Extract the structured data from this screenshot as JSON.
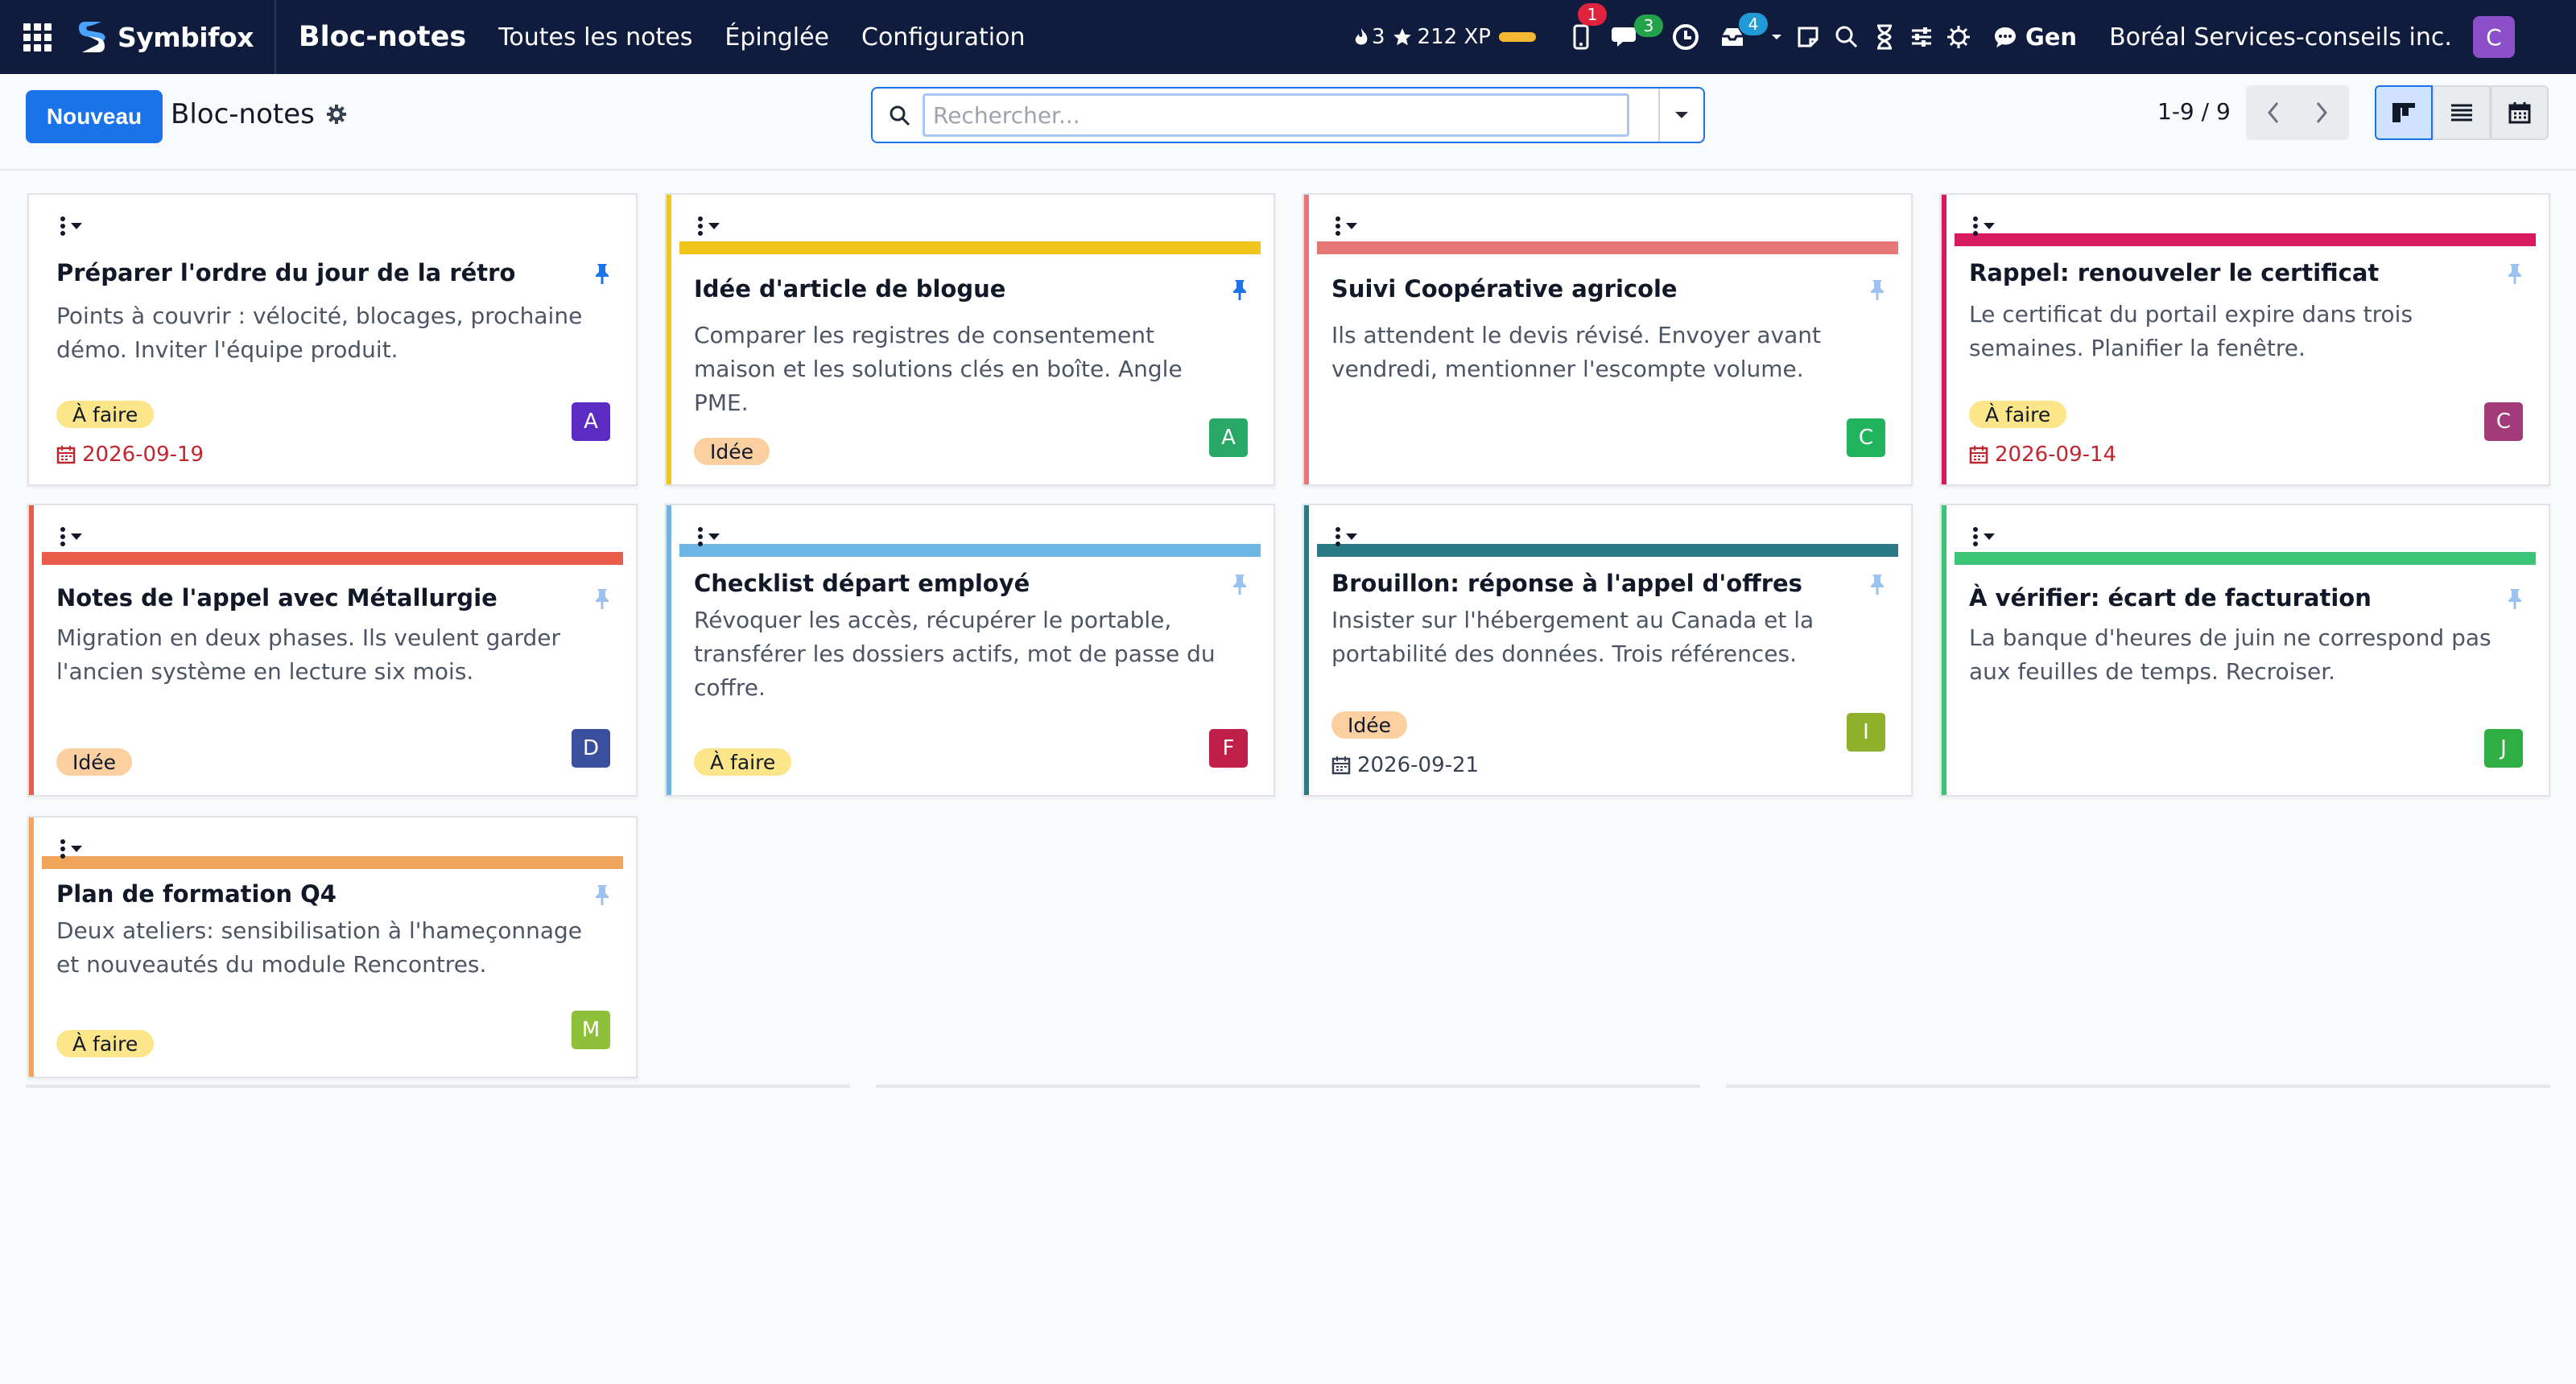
{
  "topbar": {
    "brand": "Symbifox",
    "app_title": "Bloc-notes",
    "menu": [
      "Toutes les notes",
      "Épinglée",
      "Configuration"
    ],
    "streak": "3",
    "xp": "212 XP",
    "badges": {
      "phone": "1",
      "chat": "3",
      "inbox": "4"
    },
    "gen_label": "Gen",
    "company": "Boréal Services-conseils inc.",
    "user_initial": "C"
  },
  "control": {
    "new_label": "Nouveau",
    "breadcrumb": "Bloc-notes",
    "search_placeholder": "Rechercher...",
    "pager": "1-9 / 9"
  },
  "colors": {
    "accent": "#1a73e8",
    "tag_todo": "#fde68a",
    "tag_idea": "#fbcfa0",
    "date_overdue": "#c0262d"
  },
  "notes": [
    {
      "title": "Préparer l'ordre du jour de la rétro",
      "body": "Points à couvrir : vélocité, blocages, prochaine démo. Inviter l'équipe produit.",
      "tag": "À faire",
      "date": "2026-09-19",
      "date_overdue": true,
      "avatar": "A",
      "avatar_color": "#5b2bc4",
      "color": "",
      "pinned": true
    },
    {
      "title": "Idée d'article de blogue",
      "body": "Comparer les registres de consentement maison et les solutions clés en boîte. Angle PME.",
      "tag": "Idée",
      "date": "",
      "avatar": "A",
      "avatar_color": "#28a866",
      "color": "#f2c51c",
      "pinned": true
    },
    {
      "title": "Suivi Coopérative agricole",
      "body": "Ils attendent le devis révisé. Envoyer avant vendredi, mentionner l'escompte volume.",
      "tag": "",
      "date": "",
      "avatar": "C",
      "avatar_color": "#22b35e",
      "color": "#e87878",
      "pinned": false
    },
    {
      "title": "Rappel: renouveler le certificat",
      "body": "Le certificat du portail expire dans trois semaines. Planifier la fenêtre.",
      "tag": "À faire",
      "date": "2026-09-14",
      "date_overdue": true,
      "avatar": "C",
      "avatar_color": "#a33b7a",
      "color": "#d81a5f",
      "pinned": false
    },
    {
      "title": "Notes de l'appel avec Métallurgie",
      "body": "Migration en deux phases. Ils veulent garder l'ancien système en lecture six mois.",
      "tag": "Idée",
      "date": "",
      "avatar": "D",
      "avatar_color": "#3a4f9e",
      "color": "#ea5c4a",
      "pinned": false
    },
    {
      "title": "Checklist départ employé",
      "body": "Révoquer les accès, récupérer le portable, transférer les dossiers actifs, mot de passe du coffre.",
      "tag": "À faire",
      "date": "",
      "avatar": "F",
      "avatar_color": "#c01f4a",
      "color": "#6cb6e6",
      "pinned": false
    },
    {
      "title": "Brouillon: réponse à l'appel d'offres",
      "body": "Insister sur l'hébergement au Canada et la portabilité des données. Trois références.",
      "tag": "Idée",
      "date": "2026-09-21",
      "date_overdue": false,
      "avatar": "I",
      "avatar_color": "#8fb02a",
      "color": "#2a7a86",
      "pinned": false
    },
    {
      "title": "À vérifier: écart de facturation",
      "body": "La banque d'heures de juin ne correspond pas aux feuilles de temps. Recroiser.",
      "tag": "",
      "date": "",
      "avatar": "J",
      "avatar_color": "#2fae43",
      "color": "#3cc477",
      "pinned": false
    },
    {
      "title": "Plan de formation Q4",
      "body": "Deux ateliers: sensibilisation à l'hameçonnage et nouveautés du module Rencontres.",
      "tag": "À faire",
      "date": "",
      "avatar": "M",
      "avatar_color": "#8fc03a",
      "color": "#f0a45c",
      "pinned": false
    }
  ]
}
